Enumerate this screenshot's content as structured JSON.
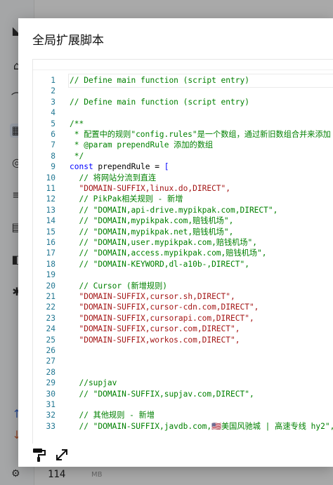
{
  "background": {
    "memory_value": "114",
    "memory_unit": "MB"
  },
  "modal": {
    "title": "全局扩展脚本",
    "footer_icons": [
      "format-icon",
      "expand-icon"
    ]
  },
  "editor": {
    "lines": [
      {
        "n": "1",
        "t": "// Define main function (script entry)",
        "k": "comment"
      },
      {
        "n": "2",
        "t": "",
        "k": "plain"
      },
      {
        "n": "3",
        "t": "// Define main function (script entry)",
        "k": "comment"
      },
      {
        "n": "4",
        "t": "",
        "k": "plain"
      },
      {
        "n": "5",
        "t": "/**",
        "k": "comment"
      },
      {
        "n": "6",
        "t": " * 配置中的规则\"config.rules\"是一个数组，通过新旧数组合并来添加",
        "k": "comment"
      },
      {
        "n": "7",
        "t": " * @param prependRule 添加的数组",
        "k": "comment"
      },
      {
        "n": "8",
        "t": " */",
        "k": "comment"
      },
      {
        "n": "9",
        "t": "const prependRule = [",
        "k": "decl"
      },
      {
        "n": "10",
        "t": "  // 将网站分流到直连",
        "k": "comment"
      },
      {
        "n": "11",
        "t": "  \"DOMAIN-SUFFIX,linux.do,DIRECT\",",
        "k": "string"
      },
      {
        "n": "12",
        "t": "  // PikPak相关规则 - 新增",
        "k": "comment"
      },
      {
        "n": "13",
        "t": "  // \"DOMAIN,api-drive.mypikpak.com,DIRECT\",",
        "k": "comment"
      },
      {
        "n": "14",
        "t": "  // \"DOMAIN,mypikpak.com,赔钱机场\",",
        "k": "comment"
      },
      {
        "n": "15",
        "t": "  // \"DOMAIN,mypikpak.net,赔钱机场\",",
        "k": "comment"
      },
      {
        "n": "16",
        "t": "  // \"DOMAIN,user.mypikpak.com,赔钱机场\",",
        "k": "comment"
      },
      {
        "n": "17",
        "t": "  // \"DOMAIN,access.mypikpak.com,赔钱机场\",",
        "k": "comment"
      },
      {
        "n": "18",
        "t": "  // \"DOMAIN-KEYWORD,dl-a10b-,DIRECT\",",
        "k": "comment"
      },
      {
        "n": "19",
        "t": "",
        "k": "plain"
      },
      {
        "n": "20",
        "t": "  // Cursor (新增规则)",
        "k": "comment"
      },
      {
        "n": "21",
        "t": "  \"DOMAIN-SUFFIX,cursor.sh,DIRECT\",",
        "k": "string"
      },
      {
        "n": "22",
        "t": "  \"DOMAIN-SUFFIX,cursor-cdn.com,DIRECT\",",
        "k": "string"
      },
      {
        "n": "23",
        "t": "  \"DOMAIN-SUFFIX,cursorapi.com,DIRECT\",",
        "k": "string"
      },
      {
        "n": "24",
        "t": "  \"DOMAIN-SUFFIX,cursor.com,DIRECT\",",
        "k": "string"
      },
      {
        "n": "25",
        "t": "  \"DOMAIN-SUFFIX,workos.com,DIRECT\",",
        "k": "string"
      },
      {
        "n": "26",
        "t": "",
        "k": "plain"
      },
      {
        "n": "27",
        "t": "",
        "k": "plain"
      },
      {
        "n": "28",
        "t": "",
        "k": "plain"
      },
      {
        "n": "29",
        "t": "  //supjav",
        "k": "comment"
      },
      {
        "n": "30",
        "t": "  // \"DOMAIN-SUFFIX,supjav.com,DIRECT\",",
        "k": "comment"
      },
      {
        "n": "31",
        "t": "",
        "k": "plain"
      },
      {
        "n": "32",
        "t": "  // 其他规则 - 新增",
        "k": "comment"
      },
      {
        "n": "33",
        "t": "  // \"DOMAIN-SUFFIX,javdb.com,🇺🇸美国风驰城 | 高速专线 hy2\",",
        "k": "comment"
      }
    ]
  },
  "colors": {
    "comment": "#008000",
    "string": "#a31515",
    "keyword": "#0000ff",
    "line_number": "#237893"
  }
}
